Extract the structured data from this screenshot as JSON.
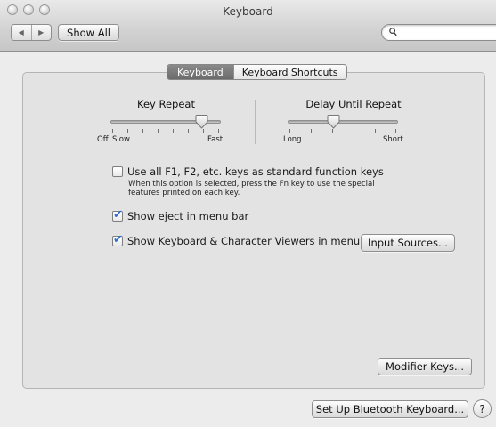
{
  "window": {
    "title": "Keyboard"
  },
  "toolbar": {
    "back_icon": "back-arrow-icon",
    "forward_icon": "forward-arrow-icon",
    "show_all_label": "Show All",
    "search_placeholder": "",
    "search_icon": "magnifier-icon"
  },
  "tabs": [
    {
      "label": "Keyboard",
      "selected": true
    },
    {
      "label": "Keyboard Shortcuts",
      "selected": false
    }
  ],
  "key_repeat": {
    "title": "Key Repeat",
    "min_label": "Off",
    "slow_label": "Slow",
    "max_label": "Fast",
    "level_fraction": 0.87
  },
  "delay_until_repeat": {
    "title": "Delay Until Repeat",
    "min_label": "Long",
    "max_label": "Short",
    "level_fraction": 0.4
  },
  "options": {
    "fn_keys": {
      "label": "Use all F1, F2, etc. keys as standard function keys",
      "checked": false,
      "description_line1": "When this option is selected, press the Fn key to use the special",
      "description_line2": "features printed on each key."
    },
    "eject": {
      "label": "Show eject in menu bar",
      "checked": true
    },
    "viewers": {
      "label": "Show Keyboard & Character Viewers in menu bar",
      "checked": true
    }
  },
  "buttons": {
    "input_sources": "Input Sources...",
    "modifier_keys": "Modifier Keys...",
    "bluetooth": "Set Up Bluetooth Keyboard...",
    "help": "?"
  },
  "colors": {
    "checkmark": "#2e6fcc",
    "selected_tab": "#7a7a7a"
  }
}
